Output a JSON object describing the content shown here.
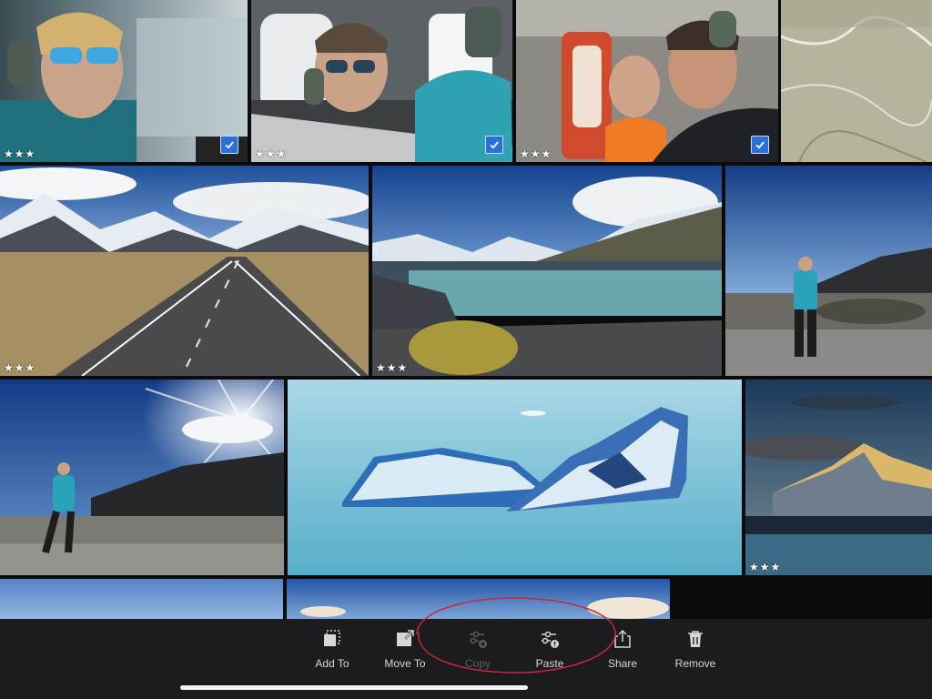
{
  "gallery": {
    "tiles": [
      {
        "id": "heli-woman-sunglasses",
        "rating": "★★★",
        "selected": true
      },
      {
        "id": "heli-pilot-headset",
        "rating": "★★★",
        "selected": true
      },
      {
        "id": "heli-couple-selfie",
        "rating": "★★★",
        "selected": true
      },
      {
        "id": "aerial-ice-terrain",
        "rating": "",
        "selected": true
      },
      {
        "id": "mountain-road",
        "rating": "★★★"
      },
      {
        "id": "glacier-lake",
        "rating": "★★★"
      },
      {
        "id": "hiker-rocks-right",
        "rating": ""
      },
      {
        "id": "hiker-sunburst",
        "rating": ""
      },
      {
        "id": "icebergs",
        "rating": ""
      },
      {
        "id": "mountain-dusk",
        "rating": "★★★"
      },
      {
        "id": "sky-partial-1",
        "rating": ""
      },
      {
        "id": "sky-partial-2",
        "rating": ""
      }
    ]
  },
  "toolbar": {
    "add_to": "Add To",
    "move_to": "Move To",
    "copy": "Copy",
    "paste": "Paste",
    "share": "Share",
    "remove": "Remove"
  },
  "colors": {
    "selection": "#2b6fdc",
    "toolbar_bg": "#1c1c1e",
    "annotation": "#c8283a"
  }
}
